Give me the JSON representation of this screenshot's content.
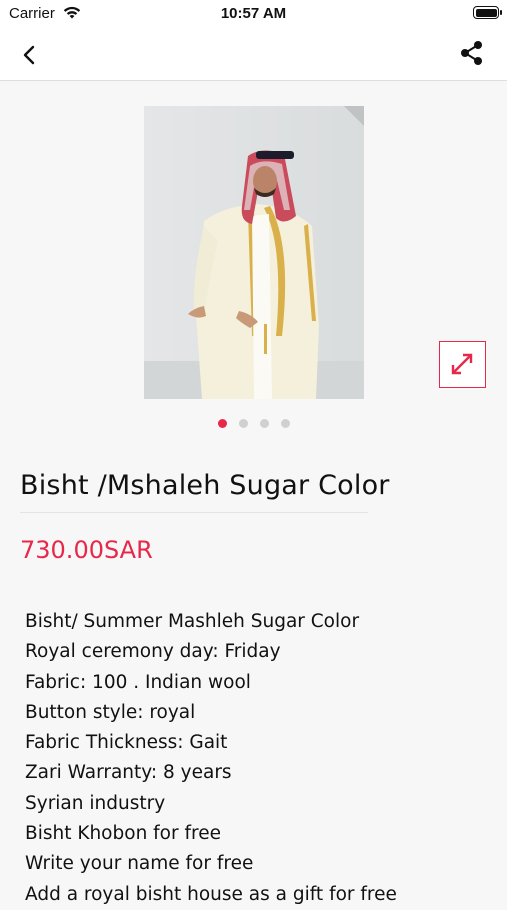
{
  "status_bar": {
    "carrier": "Carrier",
    "time": "10:57 AM"
  },
  "nav": {
    "back_icon": "chevron-left-icon",
    "share_icon": "share-icon"
  },
  "gallery": {
    "image_description": "Man wearing a cream bisht with gold trim and red-white shemagh",
    "page_count": 4,
    "current_page": 1,
    "expand_icon": "expand-arrows-icon"
  },
  "product": {
    "title": "Bisht /Mshaleh  Sugar Color",
    "price": "730.00SAR",
    "description_lines": [
      "Bisht/ Summer Mashleh Sugar Color",
      "Royal ceremony day: Friday",
      "Fabric: 100 . Indian wool",
      "Button style: royal",
      "Fabric Thickness: Gait",
      "Zari Warranty: 8 years",
      "Syrian industry",
      "Bisht Khobon for free",
      "Write your name for free",
      "Add a royal bisht house as a gift for free"
    ]
  },
  "colors": {
    "accent": "#e8284a",
    "background": "#f7f7f7"
  }
}
